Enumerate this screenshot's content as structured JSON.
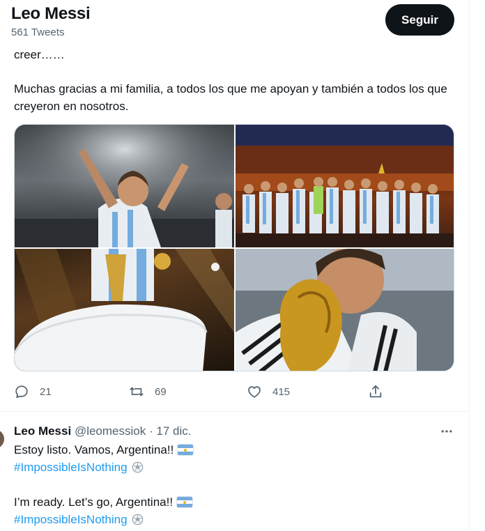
{
  "header": {
    "name": "Leo Messi",
    "tweet_count": "561 Tweets",
    "follow_label": "Seguir"
  },
  "tweet1": {
    "line1": "creer……",
    "line2": "Muchas gracias a mi familia, a todos los que me apoyan y también a todos los que creyeron en nosotros.",
    "media": [
      {
        "icon": "photo"
      },
      {
        "icon": "photo"
      },
      {
        "icon": "photo"
      },
      {
        "icon": "photo"
      }
    ],
    "actions": {
      "replies": "21",
      "retweets": "69",
      "likes": "415"
    }
  },
  "tweet2": {
    "name": "Leo Messi",
    "handle": "@leomessiok",
    "separator": "·",
    "date": "17 dic.",
    "line1": "Estoy listo. Vamos, Argentina!!",
    "hashtag1": "#ImpossibleIsNothing",
    "line2": "I’m ready. Let’s go, Argentina!!",
    "hashtag2": "#ImpossibleIsNothing"
  },
  "colors": {
    "text": "#0f1419",
    "secondary": "#536471",
    "link": "#1d9bf0",
    "button": "#0f1419",
    "border": "#eff3f4"
  },
  "icons": [
    "reply-icon",
    "retweet-icon",
    "like-icon",
    "share-icon",
    "more-icon",
    "argentina-flag-icon",
    "football-icon"
  ]
}
